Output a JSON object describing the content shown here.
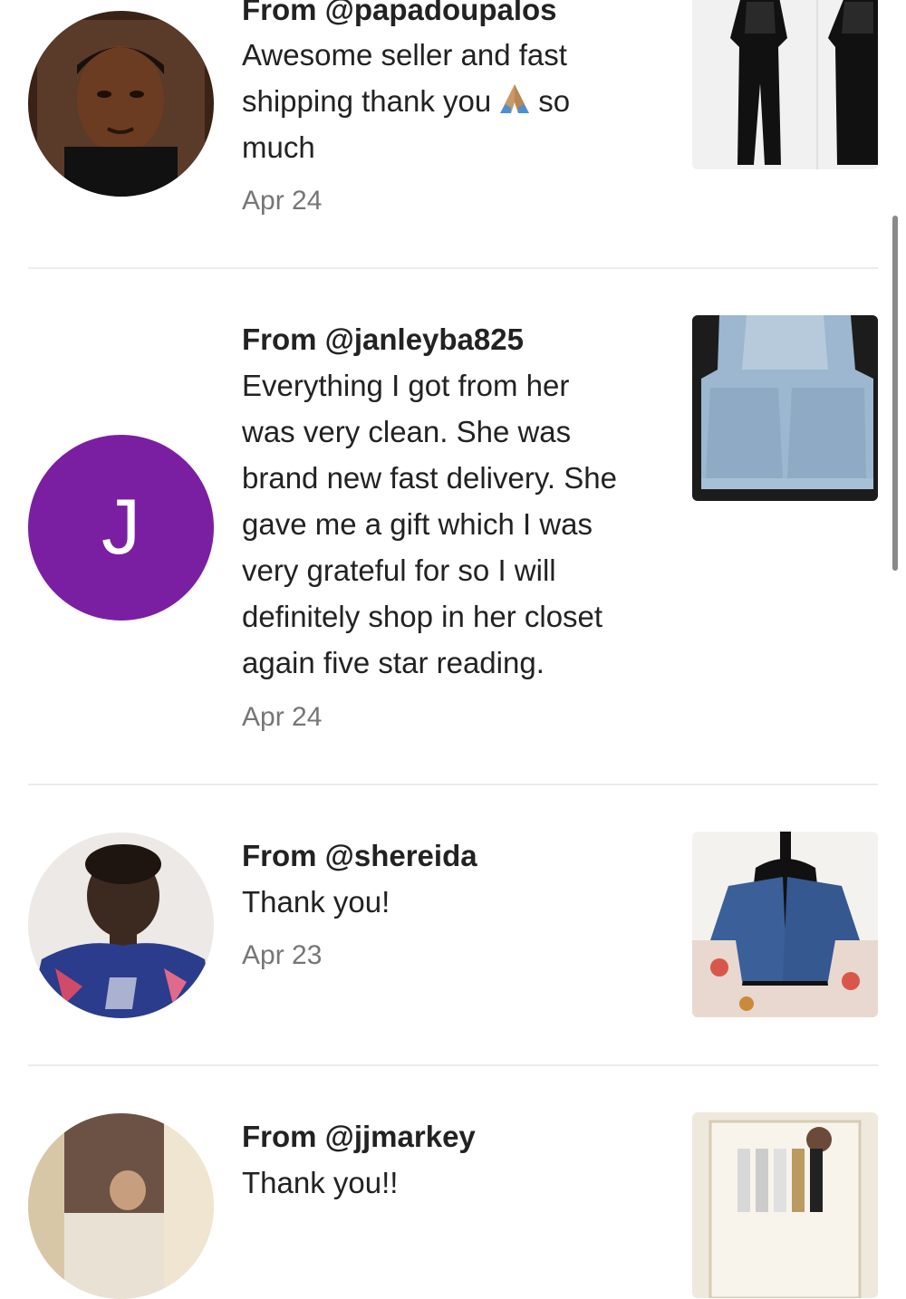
{
  "reviews": [
    {
      "from": "From @papadoupalos",
      "text_lines": [
        "Awesome seller and fast",
        "shipping thank you",
        "so",
        "much"
      ],
      "emoji": "folded-hands",
      "date": "Apr 24",
      "avatar_type": "photo",
      "product_thumb": "black-lace-jumpsuit"
    },
    {
      "from": "From @janleyba825",
      "text_lines": [
        "Everything I got from her",
        "was very clean. She was",
        "brand new fast delivery. She",
        "gave me a gift which I was",
        "very grateful for so I will",
        "definitely shop in her closet",
        "again five star reading."
      ],
      "date": "Apr 24",
      "avatar_type": "letter",
      "avatar_letter": "J",
      "avatar_color": "#7B1FA2",
      "product_thumb": "denim-overalls-shorts"
    },
    {
      "from": "From @shereida",
      "text": "Thank you!",
      "date": "Apr 23",
      "avatar_type": "photo",
      "product_thumb": "denim-crop-jacket"
    },
    {
      "from": "From @jjmarkey",
      "text": "Thank you!!",
      "avatar_type": "photo",
      "product_thumb": "boxed-product-set"
    }
  ],
  "colors": {
    "text": "#222222",
    "date": "#767676",
    "divider": "#ececec",
    "purple": "#7B1FA2"
  }
}
